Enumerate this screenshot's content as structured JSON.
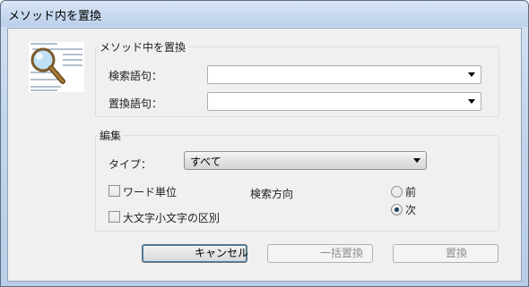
{
  "window": {
    "title": "メソッド内を置換"
  },
  "method_group": {
    "label": "メソッド中を置換",
    "search_label": "検索語句：",
    "search_value": "",
    "replace_label": "置換語句：",
    "replace_value": ""
  },
  "edit_group": {
    "label": "編集",
    "type_label": "タイプ：",
    "type_value": "すべて",
    "whole_word": {
      "label": "ワード単位",
      "checked": false
    },
    "match_case": {
      "label": "大文字小文字の区別",
      "checked": false
    },
    "direction_label": "検索方向",
    "direction_prev": {
      "label": "前",
      "selected": false
    },
    "direction_next": {
      "label": "次",
      "selected": true
    }
  },
  "buttons": {
    "cancel": "キャンセル",
    "replace_all": "一括置換",
    "replace": "置換"
  },
  "colors": {
    "title_bar": "#c7d9ef",
    "dialog_bg": "#f0f0f0",
    "button_focus": "#3c7fb1",
    "disabled_text": "#8d8d8d"
  },
  "icons": {
    "illustration": "magnifier-document-icon",
    "combo_arrow": "chevron-down-icon"
  }
}
